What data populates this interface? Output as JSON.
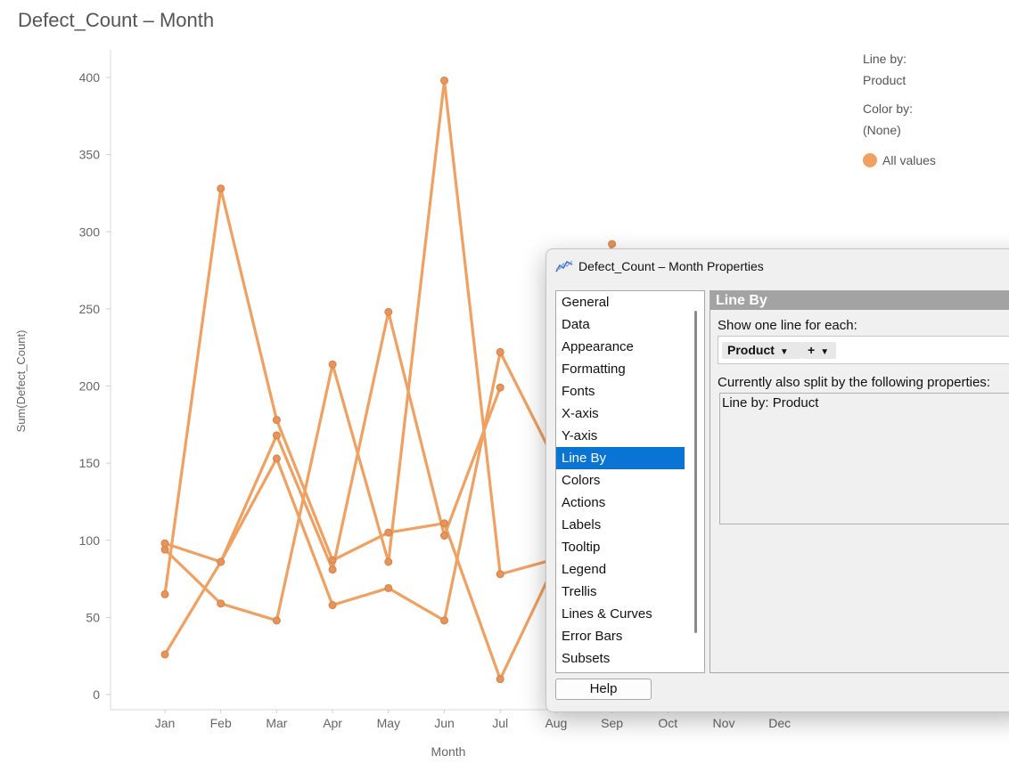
{
  "chart_data": {
    "type": "line",
    "title": "Defect_Count – Month",
    "xlabel": "Month",
    "ylabel": "Sum(Defect_Count)",
    "ylim": [
      0,
      420
    ],
    "y_ticks": [
      0,
      50,
      100,
      150,
      200,
      250,
      300,
      350,
      400
    ],
    "categories": [
      "Jan",
      "Feb",
      "Mar",
      "Apr",
      "May",
      "Jun",
      "Jul",
      "Aug",
      "Sep",
      "Oct",
      "Nov",
      "Dec"
    ],
    "color": "#f0a060",
    "series": [
      {
        "values": [
          26,
          86,
          168,
          81,
          248,
          103,
          199,
          null,
          null,
          null,
          null,
          null
        ]
      },
      {
        "values": [
          65,
          328,
          178,
          87,
          105,
          111,
          10,
          86,
          null,
          null,
          null,
          null
        ]
      },
      {
        "values": [
          94,
          59,
          48,
          214,
          86,
          398,
          78,
          88,
          null,
          null,
          null,
          null
        ]
      },
      {
        "values": [
          98,
          86,
          153,
          58,
          69,
          48,
          222,
          150,
          292,
          null,
          null,
          null
        ]
      }
    ],
    "grid": false
  },
  "legend": {
    "line_by_label": "Line by:",
    "line_by_value": "Product",
    "color_by_label": "Color by:",
    "color_by_value": "(None)",
    "item_label": "All values",
    "item_color": "#f0a060"
  },
  "dialog": {
    "title": "Defect_Count – Month Properties",
    "icon": "line-chart-icon",
    "nav_items": [
      "General",
      "Data",
      "Appearance",
      "Formatting",
      "Fonts",
      "X-axis",
      "Y-axis",
      "Line By",
      "Colors",
      "Actions",
      "Labels",
      "Tooltip",
      "Legend",
      "Trellis",
      "Lines & Curves",
      "Error Bars",
      "Subsets"
    ],
    "selected_nav": "Line By",
    "help_label": "Help",
    "panel": {
      "header": "Line By",
      "show_label": "Show one line for each:",
      "column_chip": "Product",
      "add_chip": "+",
      "split_label": "Currently also split by the following properties:",
      "split_items": [
        "Line by: Product"
      ]
    }
  }
}
